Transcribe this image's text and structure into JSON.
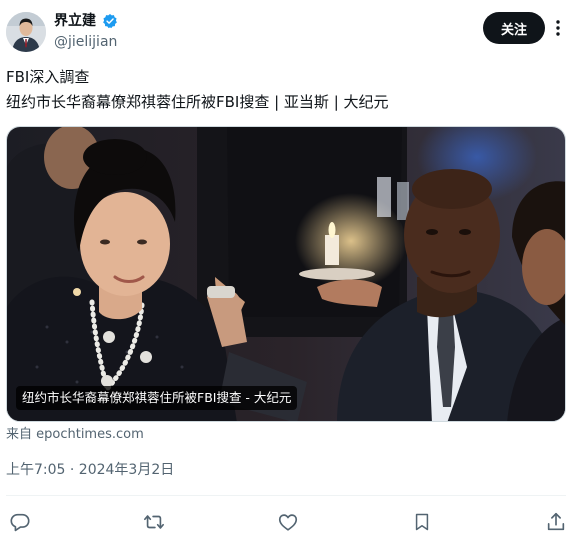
{
  "author": {
    "name": "界立建",
    "handle": "@jielijian",
    "verified": true
  },
  "follow_label": "关注",
  "tweet": {
    "line1": "FBI深入調查",
    "line2": "纽约市长华裔幕僚郑祺蓉住所被FBI搜查 | 亚当斯 | 大纪元"
  },
  "media": {
    "caption": "纽约市长华裔幕僚郑祺蓉住所被FBI搜查 - 大纪元"
  },
  "source": "来自 epochtimes.com",
  "timestamp": "上午7:05 · 2024年3月2日",
  "actions": [
    "reply-icon",
    "retweet-icon",
    "like-icon",
    "bookmark-icon",
    "share-icon"
  ],
  "colors": {
    "text": "#0f1419",
    "secondary": "#536471",
    "verified": "#1d9bf0",
    "follow_bg": "#0f1419"
  }
}
